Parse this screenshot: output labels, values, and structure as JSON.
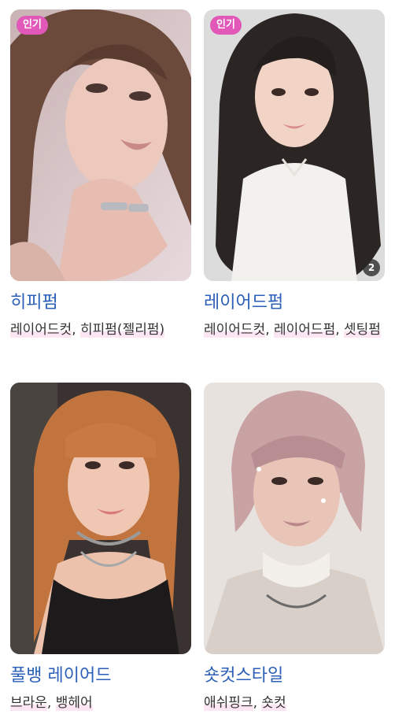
{
  "cards": [
    {
      "badge": "인기",
      "title": "히피펌",
      "tags": [
        "레이어드컷",
        "히피펌(젤리펌)"
      ],
      "separator": ", "
    },
    {
      "badge": "인기",
      "count": "2",
      "title": "레이어드펌",
      "tags": [
        "레이어드컷",
        "레이어드펌",
        "셋팅펌"
      ],
      "separator": ", "
    },
    {
      "title": "풀뱅 레이어드",
      "tags": [
        "브라운",
        "뱅헤어"
      ],
      "separator": ", "
    },
    {
      "title": "숏컷스타일",
      "tags": [
        "애쉬핑크",
        "숏컷"
      ],
      "separator": ", "
    }
  ],
  "colors": {
    "badge_bg": "#e158b9",
    "title_link": "#2b5fb8",
    "tag_highlight": "#fde6f3"
  }
}
